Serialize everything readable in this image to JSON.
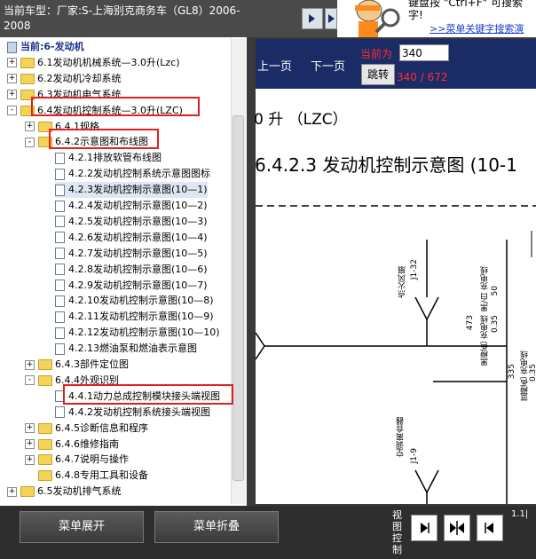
{
  "header": {
    "vehicle_line1": "当前车型：厂家:S-上海别克商务车（GL8）2006-",
    "vehicle_line2": "2008",
    "tip_line1": "键盘按 \"Ctrl+F\" 可搜索",
    "tip_line2": "字!",
    "tip_link": ">>菜单关键字搜索演"
  },
  "tree": {
    "rows": [
      {
        "label": "当前:6-发动机",
        "level": 0,
        "kind": "current"
      },
      {
        "label": "6.1发动机机械系统—3.0升(Lzc)",
        "level": 0,
        "kind": "folder",
        "pm": "+"
      },
      {
        "label": "6.2发动机冷却系统",
        "level": 0,
        "kind": "folder",
        "pm": "+"
      },
      {
        "label": "6.3发动机电气系统",
        "level": 0,
        "kind": "folder",
        "pm": "+"
      },
      {
        "label": "6.4发动机控制系统—3.0升(LZC)",
        "level": 0,
        "kind": "folder",
        "pm": "-"
      },
      {
        "label": "6.4.1规格",
        "level": 1,
        "kind": "folder",
        "pm": "+"
      },
      {
        "label": "6.4.2示意图和布线图",
        "level": 1,
        "kind": "folder",
        "pm": "-"
      },
      {
        "label": "4.2.1排放软管布线图",
        "level": 2,
        "kind": "doc"
      },
      {
        "label": "4.2.2发动机控制系统示意图图标",
        "level": 2,
        "kind": "doc"
      },
      {
        "label": "4.2.3发动机控制示意图(10—1)",
        "level": 2,
        "kind": "doc",
        "selected": true
      },
      {
        "label": "4.2.4发动机控制示意图(10—2)",
        "level": 2,
        "kind": "doc"
      },
      {
        "label": "4.2.5发动机控制示意图(10—3)",
        "level": 2,
        "kind": "doc"
      },
      {
        "label": "4.2.6发动机控制示意图(10—4)",
        "level": 2,
        "kind": "doc"
      },
      {
        "label": "4.2.7发动机控制示意图(10—5)",
        "level": 2,
        "kind": "doc"
      },
      {
        "label": "4.2.8发动机控制示意图(10—6)",
        "level": 2,
        "kind": "doc"
      },
      {
        "label": "4.2.9发动机控制示意图(10—7)",
        "level": 2,
        "kind": "doc"
      },
      {
        "label": "4.2.10发动机控制示意图(10—8)",
        "level": 2,
        "kind": "doc"
      },
      {
        "label": "4.2.11发动机控制示意图(10—9)",
        "level": 2,
        "kind": "doc"
      },
      {
        "label": "4.2.12发动机控制示意图(10—10)",
        "level": 2,
        "kind": "doc"
      },
      {
        "label": "4.2.13燃油泵和燃油表示意图",
        "level": 2,
        "kind": "doc"
      },
      {
        "label": "6.4.3部件定位图",
        "level": 1,
        "kind": "folder",
        "pm": "+"
      },
      {
        "label": "6.4.4外观识别",
        "level": 1,
        "kind": "folder",
        "pm": "-"
      },
      {
        "label": "4.4.1动力总成控制模块接头端视图",
        "level": 2,
        "kind": "doc"
      },
      {
        "label": "4.4.2发动机控制系统接头端视图",
        "level": 2,
        "kind": "doc"
      },
      {
        "label": "6.4.5诊断信息和程序",
        "level": 1,
        "kind": "folder",
        "pm": "+"
      },
      {
        "label": "6.4.6维修指南",
        "level": 1,
        "kind": "folder",
        "pm": "+"
      },
      {
        "label": "6.4.7说明与操作",
        "level": 1,
        "kind": "folder",
        "pm": "+"
      },
      {
        "label": "6.4.8专用工具和设备",
        "level": 1,
        "kind": "folder",
        "pm": ""
      },
      {
        "label": "6.5发动机排气系统",
        "level": 0,
        "kind": "folder",
        "pm": "+"
      }
    ]
  },
  "nav": {
    "prev_label": "上一页",
    "next_label": "下一页",
    "current_label": "当前为",
    "page_value": "340",
    "jump_label": "跳转",
    "page_count": "340 / 672"
  },
  "document": {
    "subtitle": "0 升 （LZC）",
    "title": "6.4.2.3 发动机控制示意图 (10-1",
    "labels": {
      "l1": "点火风扇",
      "l2": "J1-32",
      "l3": "黑/白 充电线",
      "l4": "50",
      "l5": "473",
      "l6": "黑橙色 充电线",
      "l7": "0.35",
      "l8": "335",
      "l9": "蓝橙色 充电线",
      "l10": "0.35",
      "l11": "空调离合器",
      "l12": "J1-9"
    }
  },
  "bottom": {
    "expand_label": "菜单展开",
    "collapse_label": "菜单折叠",
    "view_label": "视图控制",
    "zoom_text": "1.1|"
  },
  "colors": {
    "nav_bg": "#1b2b66",
    "highlight_red": "#e02020",
    "page_red": "#ff3030"
  }
}
